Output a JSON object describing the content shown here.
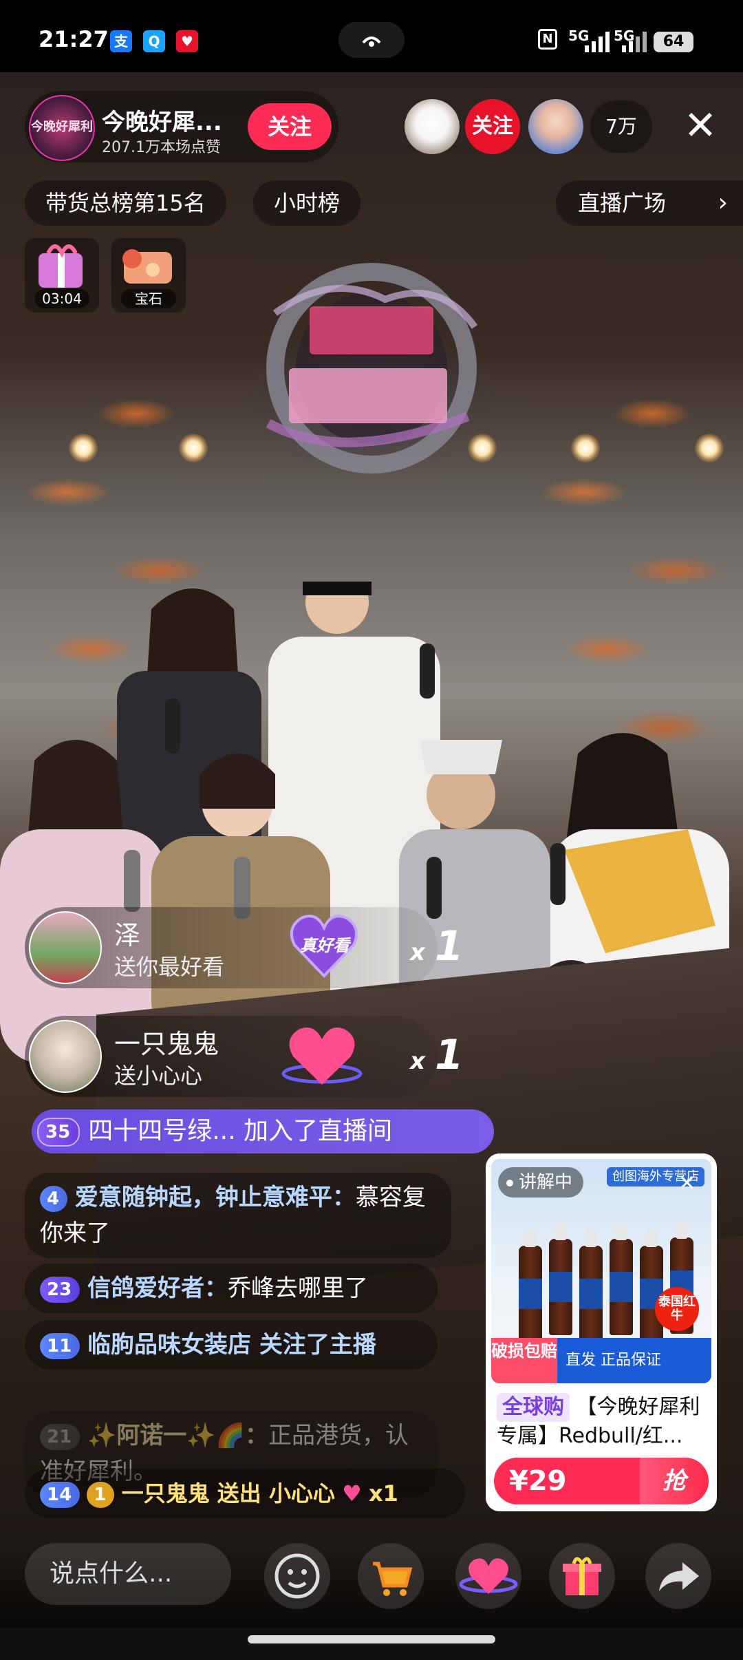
{
  "status_bar": {
    "time": "21:27",
    "signal_1": "5G",
    "signal_2": "5G",
    "battery": "64"
  },
  "host": {
    "name": "今晚好犀...",
    "likes": "207.1万本场点赞",
    "follow_label": "关注",
    "avatar_text": "今晚好犀利"
  },
  "viewers": {
    "follow_label": "关注",
    "count": "7万"
  },
  "rank": {
    "total_rank": "带货总榜第15名",
    "hour_rank": "小时榜",
    "plaza": "直播广场"
  },
  "badges": [
    {
      "label": "03:04"
    },
    {
      "label": "宝石"
    }
  ],
  "gifts": [
    {
      "user": "泽",
      "desc": "送你最好看",
      "gift_name": "真好看",
      "count": "1"
    },
    {
      "user": "一只鬼鬼",
      "desc": "送小心心",
      "count": "1"
    }
  ],
  "join": {
    "level": "35",
    "text": "四十四号绿... 加入了直播间"
  },
  "comments": [
    {
      "level": "4",
      "nick": "爱意随钟起，钟止意难平：",
      "text": "慕容复你来了"
    },
    {
      "level": "23",
      "nick": "信鸽爱好者：",
      "text": "乔峰去哪里了"
    },
    {
      "level": "11",
      "nick": "临朐品味女装店 关注了主播",
      "text": ""
    },
    {
      "level": "21",
      "nick": "✨阿诺一✨🌈：",
      "text": "正品港货，认准好犀利。"
    },
    {
      "level": "14",
      "fan_level": "1",
      "nick": "一只鬼鬼 送出 小心心",
      "text": "x1"
    }
  ],
  "product": {
    "live_tag": "讲解中",
    "store": "创图海外专营店",
    "ribbon_left": "破损包赔",
    "ribbon_right": "直发 正品保证",
    "badge": "泰国红牛",
    "global": "全球购",
    "title": "【今晚好犀利专属】Redbull/红...",
    "price": "¥29",
    "grab": "抢"
  },
  "bottom": {
    "placeholder": "说点什么..."
  },
  "colors": {
    "accent_red": "#fe2c55",
    "join_purple": "#6a4de0",
    "nick_blue": "#b9d8ff"
  }
}
